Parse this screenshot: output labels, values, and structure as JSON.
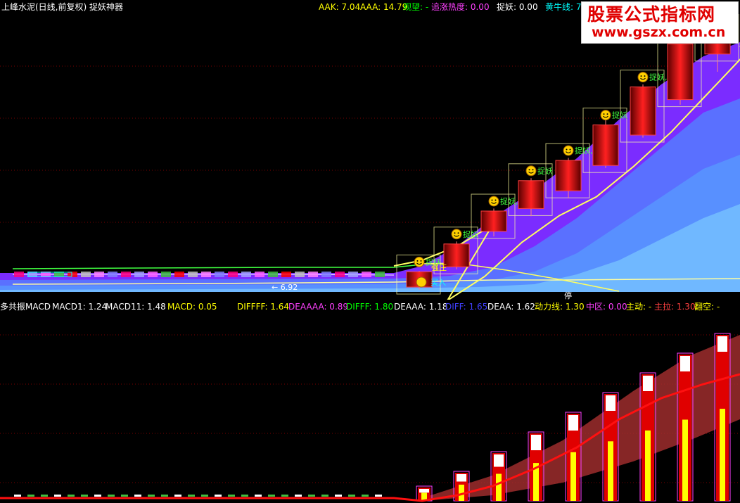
{
  "main_panel": {
    "title": "上峰水泥(日线,前复权) 捉妖神器",
    "indicators": [
      {
        "label": "AAK: 7.04",
        "color": "#ffff00"
      },
      {
        "label": "AAA: 14.79",
        "color": "#ffff00"
      },
      {
        "label": "观望: -",
        "color": "#00ff00"
      },
      {
        "label": "追涨热度: 0.00",
        "color": "#ff40ff"
      },
      {
        "label": "捉妖: 0.00",
        "color": "#ffffff"
      },
      {
        "label": "黄牛线: 7",
        "color": "#00ffff"
      }
    ],
    "annotations": {
      "zhuoyao": "捉妖",
      "zhuoyao_comma": "捉妖,",
      "qiangshi": "强庄",
      "mairu": "买入",
      "stop": "停",
      "low_mark": "← 6.92"
    }
  },
  "sub_panel": {
    "indicators": [
      {
        "label": "多共振MACD",
        "color": "#ffffff"
      },
      {
        "label": "MACD1: 1.24",
        "color": "#ffffff"
      },
      {
        "label": "MACD11: 1.48",
        "color": "#ffffff"
      },
      {
        "label": "MACD: 0.05",
        "color": "#ffff00"
      },
      {
        "label": "DIFFFF: 1.64",
        "color": "#ffff00"
      },
      {
        "label": "DEAAAA: 0.89",
        "color": "#ff40ff"
      },
      {
        "label": "DIFFF: 1.80",
        "color": "#00ff00"
      },
      {
        "label": "DEAAA: 1.18",
        "color": "#ffffff"
      },
      {
        "label": "DIFF: 1.65",
        "color": "#4040ff"
      },
      {
        "label": "DEAA: 1.62",
        "color": "#ffffff"
      },
      {
        "label": "动力线: 1.30",
        "color": "#ffff00"
      },
      {
        "label": "中区: 0.00",
        "color": "#ff40ff"
      },
      {
        "label": "主动: -",
        "color": "#ffff00"
      },
      {
        "label": "主拉: 1.30",
        "color": "#ff4040"
      },
      {
        "label": "翻空: -",
        "color": "#ffff00"
      }
    ]
  },
  "watermark": {
    "line1": "股票公式指标网",
    "line2": "www.gszx.com.cn"
  },
  "colors": {
    "background": "#000000",
    "up_candle": "#d00000",
    "frame_line": "#ffff80",
    "ma_line": "#ffff60",
    "band_violet": "#7b2cff",
    "band_blue": "#5a70ff",
    "band_light": "#70b8ff",
    "macd_band": "#a83030",
    "macd_line": "#ff1010"
  },
  "chart_data": {
    "type": "candlestick",
    "symbol": "上峰水泥",
    "period": "日线",
    "adjust": "前复权",
    "title": "上峰水泥(日线,前复权) 捉妖神器",
    "marked_low": 6.92,
    "flat_bars": 28,
    "rally_candles": [
      {
        "open": 0.0,
        "close": 0.3,
        "high": 0.32,
        "low": -0.05
      },
      {
        "open": 0.4,
        "close": 0.85,
        "high": 0.9,
        "low": 0.35
      },
      {
        "open": 1.1,
        "close": 1.5,
        "high": 1.55,
        "low": 1.0
      },
      {
        "open": 1.55,
        "close": 2.1,
        "high": 2.15,
        "low": 1.4
      },
      {
        "open": 1.9,
        "close": 2.5,
        "high": 2.55,
        "low": 1.75
      },
      {
        "open": 2.4,
        "close": 3.2,
        "high": 3.3,
        "low": 2.35
      },
      {
        "open": 3.0,
        "close": 3.95,
        "high": 4.0,
        "low": 2.95
      },
      {
        "open": 3.7,
        "close": 4.8,
        "high": 4.85,
        "low": 3.6
      },
      {
        "open": 4.6,
        "close": 5.45,
        "high": 5.55,
        "low": 4.25
      }
    ],
    "sub_macd": {
      "type": "bar",
      "values": [
        0.3,
        0.6,
        1.0,
        1.4,
        1.8,
        2.2,
        2.6,
        3.0,
        3.4
      ],
      "series": [
        {
          "name": "MACD1",
          "last": 1.24
        },
        {
          "name": "MACD11",
          "last": 1.48
        },
        {
          "name": "DIFF",
          "last": 1.65
        },
        {
          "name": "DEAA",
          "last": 1.62
        }
      ]
    }
  }
}
